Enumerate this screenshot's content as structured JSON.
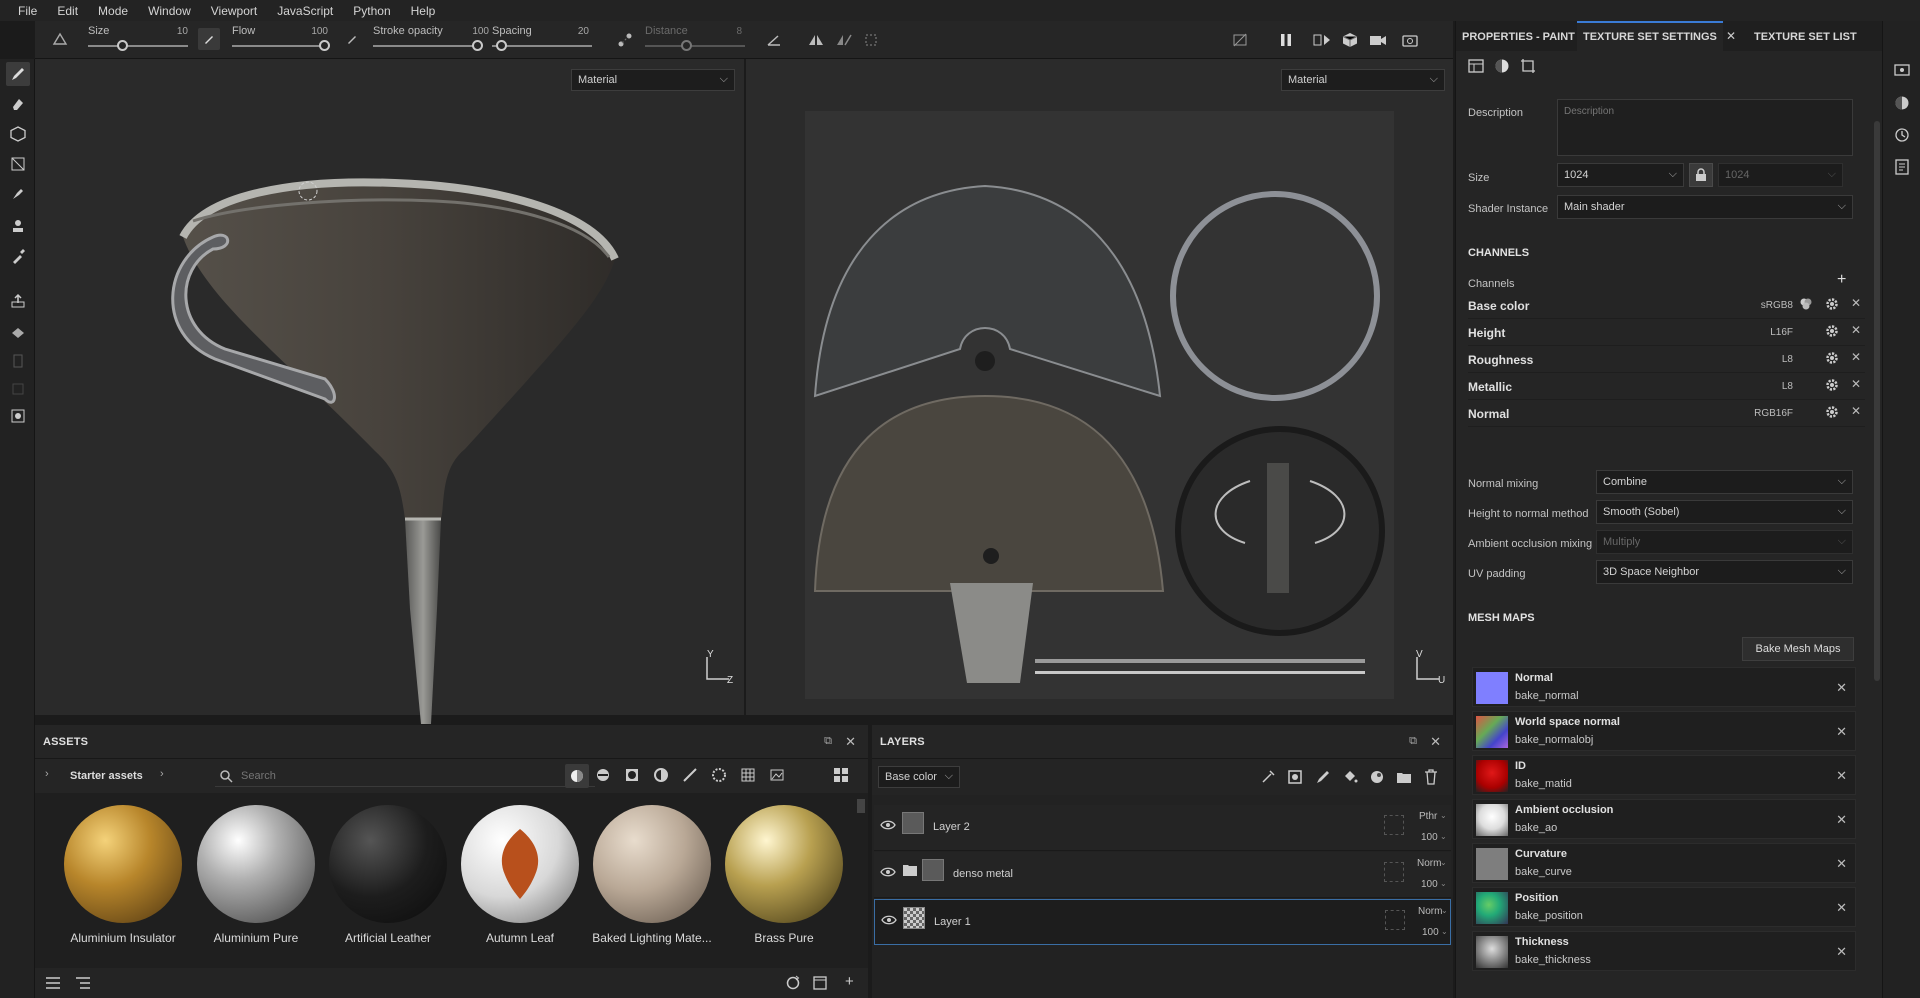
{
  "menu": [
    "File",
    "Edit",
    "Mode",
    "Window",
    "Viewport",
    "JavaScript",
    "Python",
    "Help"
  ],
  "toolbar": {
    "size_label": "Size",
    "size_value": "10",
    "flow_label": "Flow",
    "flow_value": "100",
    "stroke_opacity_label": "Stroke opacity",
    "stroke_opacity_value": "100",
    "spacing_label": "Spacing",
    "spacing_value": "20",
    "distance_label": "Distance",
    "distance_value": "8"
  },
  "viewport3d": {
    "mode": "Material",
    "axis_y": "Y",
    "axis_x": "Z"
  },
  "viewportuv": {
    "mode": "Material",
    "axis_y": "V",
    "axis_x": "U"
  },
  "assets": {
    "title": "ASSETS",
    "breadcrumb": "Starter assets",
    "search_placeholder": "Search",
    "items": [
      {
        "label": "Aluminium Insulator",
        "color": "#b8862b"
      },
      {
        "label": "Aluminium Pure",
        "color": "#c9c9c9"
      },
      {
        "label": "Artificial Leather",
        "color": "#2a2a2a"
      },
      {
        "label": "Autumn Leaf",
        "color": "#e8e8e8"
      },
      {
        "label": "Baked Lighting Mate...",
        "color": "#b9a896"
      },
      {
        "label": "Brass Pure",
        "color": "#b8a050"
      }
    ]
  },
  "layers": {
    "title": "LAYERS",
    "channel": "Base color",
    "rows": [
      {
        "name": "Layer 2",
        "blend": "Pthr",
        "opacity": "100"
      },
      {
        "name": "denso metal",
        "blend": "Norm",
        "opacity": "100"
      },
      {
        "name": "Layer 1",
        "blend": "Norm",
        "opacity": "100"
      }
    ]
  },
  "right_panel": {
    "tabs": [
      "PROPERTIES - PAINT",
      "TEXTURE SET SETTINGS",
      "TEXTURE SET LIST"
    ],
    "description_label": "Description",
    "description_placeholder": "Description",
    "size_label": "Size",
    "size_value": "1024",
    "size_value2": "1024",
    "shader_label": "Shader Instance",
    "shader_value": "Main shader",
    "channels_title": "CHANNELS",
    "channels_label": "Channels",
    "channels": [
      {
        "name": "Base color",
        "format": "sRGB8"
      },
      {
        "name": "Height",
        "format": "L16F"
      },
      {
        "name": "Roughness",
        "format": "L8"
      },
      {
        "name": "Metallic",
        "format": "L8"
      },
      {
        "name": "Normal",
        "format": "RGB16F"
      }
    ],
    "settings": [
      {
        "label": "Normal mixing",
        "value": "Combine"
      },
      {
        "label": "Height to normal method",
        "value": "Smooth (Sobel)"
      },
      {
        "label": "Ambient occlusion mixing",
        "value": "Multiply"
      },
      {
        "label": "UV padding",
        "value": "3D Space Neighbor"
      }
    ],
    "mesh_maps_title": "MESH MAPS",
    "bake_button": "Bake Mesh Maps",
    "mesh_maps": [
      {
        "name": "Normal",
        "sub": "bake_normal",
        "color": "#7f7fff"
      },
      {
        "name": "World space normal",
        "sub": "bake_normalobj",
        "color": "#8a6ad0"
      },
      {
        "name": "ID",
        "sub": "bake_matid",
        "color": "#c81818"
      },
      {
        "name": "Ambient occlusion",
        "sub": "bake_ao",
        "color": "#dedede"
      },
      {
        "name": "Curvature",
        "sub": "bake_curve",
        "color": "#808080"
      },
      {
        "name": "Position",
        "sub": "bake_position",
        "color": "#3a9a70"
      },
      {
        "name": "Thickness",
        "sub": "bake_thickness",
        "color": "#909090"
      }
    ]
  }
}
